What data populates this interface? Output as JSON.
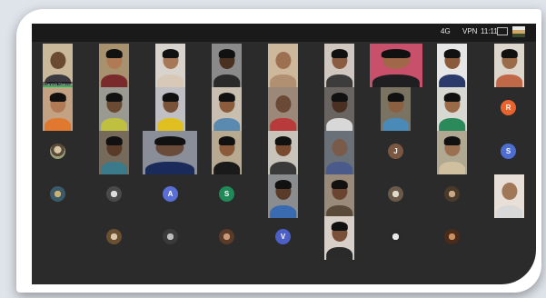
{
  "status_bar": {
    "network": "4G",
    "vpn": "VPN",
    "time": "11:11"
  },
  "meeting": {
    "first_tile_name": "Ganesh Shanmuganathan"
  },
  "letter_avatars": [
    {
      "letter": "R",
      "color": "#e8632e"
    },
    {
      "letter": "J",
      "color": "#7b5742"
    },
    {
      "letter": "S",
      "color": "#4c6ed1"
    },
    {
      "letter": "A",
      "color": "#5a6fd6"
    },
    {
      "letter": "S",
      "color": "#1f8a57"
    },
    {
      "letter": "V",
      "color": "#4b5fc6"
    }
  ]
}
